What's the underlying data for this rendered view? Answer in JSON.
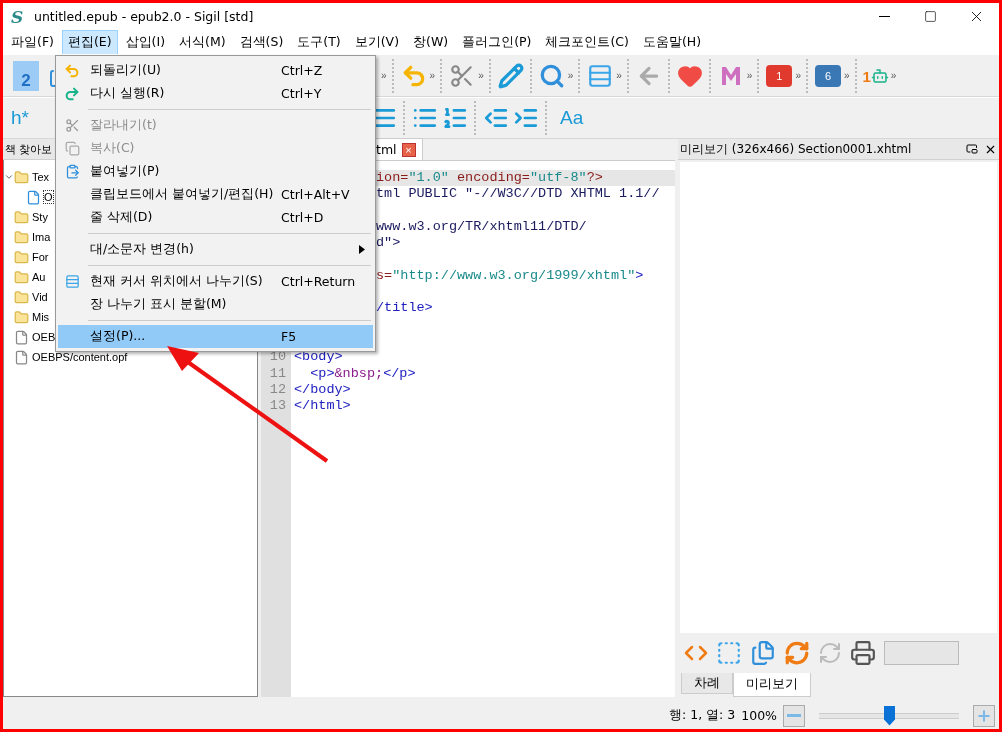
{
  "window": {
    "logo": "S",
    "title": "untitled.epub - epub2.0 - Sigil [std]"
  },
  "menubar": [
    {
      "label": "파일(F)",
      "selected": false
    },
    {
      "label": "편집(E)",
      "selected": true
    },
    {
      "label": "삽입(I)",
      "selected": false
    },
    {
      "label": "서식(M)",
      "selected": false
    },
    {
      "label": "검색(S)",
      "selected": false
    },
    {
      "label": "도구(T)",
      "selected": false
    },
    {
      "label": "보기(V)",
      "selected": false
    },
    {
      "label": "창(W)",
      "selected": false
    },
    {
      "label": "플러그인(P)",
      "selected": false
    },
    {
      "label": "체크포인트(C)",
      "selected": false
    },
    {
      "label": "도움말(H)",
      "selected": false
    }
  ],
  "toolbar_top": {
    "left": [
      {
        "kind": "page",
        "label": "2"
      },
      {
        "kind": "tool"
      }
    ],
    "right": [
      {
        "kind": "more",
        "label": "»"
      },
      {
        "kind": "grip"
      },
      {
        "kind": "tool"
      },
      {
        "kind": "more",
        "label": "»"
      },
      {
        "kind": "grip"
      },
      {
        "kind": "tool"
      },
      {
        "kind": "more",
        "label": "»"
      },
      {
        "kind": "grip"
      },
      {
        "kind": "tool"
      },
      {
        "kind": "grip"
      },
      {
        "kind": "tool"
      },
      {
        "kind": "more",
        "label": "»"
      },
      {
        "kind": "grip"
      },
      {
        "kind": "tool"
      },
      {
        "kind": "more",
        "label": "»"
      },
      {
        "kind": "grip"
      },
      {
        "kind": "tool"
      },
      {
        "kind": "grip"
      },
      {
        "kind": "tool"
      },
      {
        "kind": "grip"
      },
      {
        "kind": "tool"
      },
      {
        "kind": "more",
        "label": "»"
      },
      {
        "kind": "grip"
      },
      {
        "kind": "plugin",
        "label": "1",
        "color": "#e03a2f"
      },
      {
        "kind": "more",
        "label": "»"
      },
      {
        "kind": "grip"
      },
      {
        "kind": "plugin",
        "label": "6",
        "color": "#3a78b5"
      },
      {
        "kind": "more",
        "label": "»"
      },
      {
        "kind": "grip"
      },
      {
        "kind": "robot",
        "label": "1"
      },
      {
        "kind": "more",
        "label": "»"
      }
    ]
  },
  "toolbar_bottom": {
    "left": [
      {
        "kind": "text",
        "label": "h*"
      }
    ],
    "right": [
      {
        "kind": "tool"
      },
      {
        "kind": "grip"
      },
      {
        "kind": "tool"
      },
      {
        "kind": "tool"
      },
      {
        "kind": "grip"
      },
      {
        "kind": "tool"
      },
      {
        "kind": "tool"
      },
      {
        "kind": "grip"
      },
      {
        "kind": "text",
        "label": "Aa"
      }
    ]
  },
  "book_browser": {
    "title": "책 찾아보",
    "tree": [
      {
        "kind": "folder",
        "label": "Tex",
        "expanded": true,
        "children": [
          {
            "kind": "html",
            "label": "O",
            "selected": true
          }
        ]
      },
      {
        "kind": "folder",
        "label": "Sty"
      },
      {
        "kind": "folder",
        "label": "Ima"
      },
      {
        "kind": "folder",
        "label": "For"
      },
      {
        "kind": "folder",
        "label": "Au"
      },
      {
        "kind": "folder",
        "label": "Vid"
      },
      {
        "kind": "folder",
        "label": "Mis"
      },
      {
        "kind": "file",
        "label": "OEB"
      },
      {
        "kind": "file",
        "label": "OEBPS/content.opf"
      }
    ]
  },
  "editor": {
    "tab": {
      "label": "tml",
      "close": "×"
    },
    "lines": [
      {
        "current": true,
        "segments": [
          {
            "kind": "attr",
            "text": "ion="
          },
          {
            "kind": "string",
            "text": "\"1.0\""
          },
          {
            "kind": "attr",
            "text": " encoding="
          },
          {
            "kind": "string",
            "text": "\"utf-8\""
          },
          {
            "kind": "attr",
            "text": "?>"
          }
        ]
      },
      {
        "current": false,
        "segments": [
          {
            "kind": "doctype",
            "text": "tml PUBLIC \"-//W3C//DTD XHTML 1.1//"
          }
        ]
      },
      {
        "current": false
      },
      {
        "current": false,
        "segments": [
          {
            "kind": "doctype",
            "text": "www.w3.org/TR/xhtml11/DTD/"
          }
        ]
      },
      {
        "current": false,
        "segments": [
          {
            "kind": "doctype",
            "text": "d\">"
          }
        ]
      },
      {
        "current": false
      },
      {
        "current": false,
        "segments": [
          {
            "kind": "attr",
            "text": "s="
          },
          {
            "kind": "string",
            "text": "\"http://www.w3.org/1999/xhtml\""
          },
          {
            "kind": "tag",
            "text": ">"
          }
        ]
      },
      {
        "current": false
      },
      {
        "current": false,
        "segments": [
          {
            "kind": "tag",
            "text": "/title>"
          }
        ]
      },
      {
        "current": false
      },
      {
        "current": false
      },
      {
        "number": "10",
        "current": false,
        "segments": [
          {
            "kind": "tag",
            "text": "<body>"
          }
        ]
      },
      {
        "number": "11",
        "current": false,
        "segments": [
          {
            "kind": "tag",
            "text": "  <p>"
          },
          {
            "kind": "entity",
            "text": "&nbsp;"
          },
          {
            "kind": "tag",
            "text": "</p>"
          }
        ]
      },
      {
        "number": "12",
        "current": false,
        "segments": [
          {
            "kind": "tag",
            "text": "</body>"
          }
        ]
      },
      {
        "number": "13",
        "current": false,
        "segments": [
          {
            "kind": "tag",
            "text": "</html>"
          }
        ]
      }
    ]
  },
  "preview": {
    "title": "미리보기 (326x466) Section0001.xhtml",
    "tabs": [
      {
        "label": "차례",
        "selected": false
      },
      {
        "label": "미리보기",
        "selected": true
      }
    ]
  },
  "status_bar": {
    "position": "행: 1, 열: 3",
    "zoom": "100%",
    "zoom_slider": {
      "level": 0.5
    }
  },
  "edit_menu": [
    {
      "kind": "command",
      "label": "되돌리기(U)",
      "shortcut": "Ctrl+Z",
      "disabled": false,
      "submenu": false,
      "selected": false
    },
    {
      "kind": "command",
      "label": "다시 실행(R)",
      "shortcut": "Ctrl+Y",
      "disabled": false,
      "submenu": false,
      "selected": false
    },
    {
      "kind": "separator"
    },
    {
      "kind": "command",
      "label": "잘라내기(t)",
      "disabled": true,
      "submenu": false,
      "selected": false
    },
    {
      "kind": "command",
      "label": "복사(C)",
      "disabled": true,
      "submenu": false,
      "selected": false
    },
    {
      "kind": "command",
      "label": "붙여넣기(P)",
      "disabled": false,
      "submenu": false,
      "selected": false
    },
    {
      "kind": "command",
      "label": "클립보드에서 붙여넣기/편집(H)",
      "shortcut": "Ctrl+Alt+V",
      "disabled": false,
      "submenu": false,
      "selected": false
    },
    {
      "kind": "command",
      "label": "줄 삭제(D)",
      "shortcut": "Ctrl+D",
      "disabled": false,
      "submenu": false,
      "selected": false
    },
    {
      "kind": "separator"
    },
    {
      "kind": "command",
      "label": "대/소문자 변경(h)",
      "disabled": false,
      "submenu": true,
      "selected": false
    },
    {
      "kind": "separator"
    },
    {
      "kind": "command",
      "label": "현재 커서 위치에서 나누기(S)",
      "shortcut": "Ctrl+Return",
      "disabled": false,
      "submenu": false,
      "selected": false
    },
    {
      "kind": "command",
      "label": "장 나누기 표시 분할(M)",
      "disabled": false,
      "submenu": false,
      "selected": false
    },
    {
      "kind": "separator"
    },
    {
      "kind": "command",
      "label": "설정(P)...",
      "shortcut": "F5",
      "disabled": false,
      "submenu": false,
      "selected": true
    }
  ]
}
